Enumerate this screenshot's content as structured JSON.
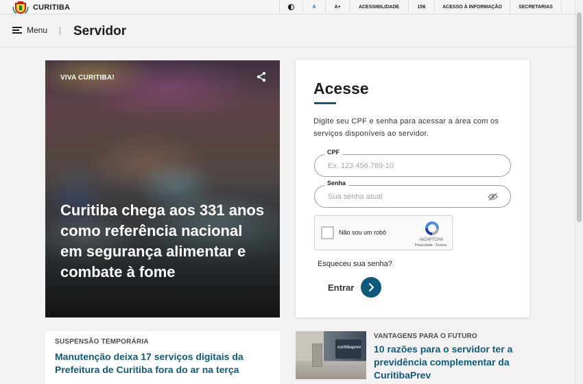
{
  "topbar": {
    "brand_name": "CURITIBA",
    "font_small": "A",
    "font_large": "A+",
    "accessibility": "ACESSIBILIDADE",
    "phone_156": "156",
    "info_access": "ACESSO À INFORMAÇÃO",
    "departments": "SECRETARIAS"
  },
  "header": {
    "menu_label": "Menu",
    "title": "Servidor"
  },
  "hero": {
    "kicker": "VIVA CURITIBA!",
    "headline": "Curitiba chega aos 331 anos como referência nacional em segurança alimentar e combate à fome"
  },
  "login": {
    "title": "Acesse",
    "description": "Digite seu CPF e senha para acessar a área com os serviços disponíveis ao servidor.",
    "cpf_label": "CPF",
    "cpf_placeholder": "Ex. 123.456.789-10",
    "password_label": "Senha",
    "password_placeholder": "Sua senha atual",
    "captcha_label": "Não sou um robô",
    "captcha_brand": "reCAPTCHA",
    "captcha_links": "Privacidade - Termos",
    "forgot": "Esqueceu sua senha?",
    "submit": "Entrar"
  },
  "news": [
    {
      "kicker": "SUSPENSÃO TEMPORÁRIA",
      "title": "Manutenção deixa 17 serviços digitais da Prefeitura de Curitiba fora do ar na terça"
    },
    {
      "kicker": "VANTAGENS PARA O FUTURO",
      "title": "10 razões para o servidor ter a previdência complementar da CuritibaPrev",
      "thumb_text": "curitibaprev"
    }
  ],
  "colors": {
    "accent": "#0e5a7a",
    "brand_red": "#c8161d",
    "brand_green": "#1f7a3a"
  },
  "icons": [
    "curitiba-seal-icon",
    "contrast-icon",
    "hamburger-icon",
    "share-icon",
    "eye-slash-icon",
    "recaptcha-icon",
    "arrow-right-icon"
  ]
}
